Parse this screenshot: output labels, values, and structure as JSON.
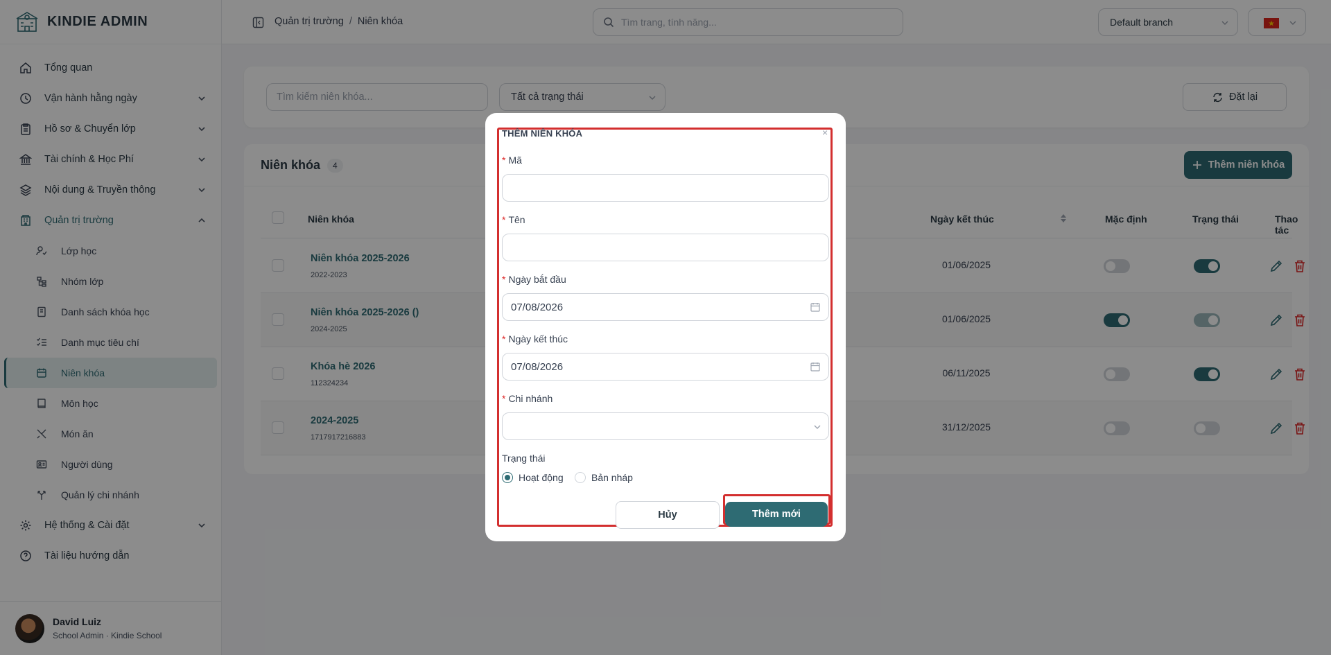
{
  "app": {
    "name": "KINDIE ADMIN"
  },
  "sidebar": {
    "items": [
      {
        "label": "Tổng quan",
        "icon": "home-icon"
      },
      {
        "label": "Vận hành hằng ngày",
        "icon": "clock-icon"
      },
      {
        "label": "Hồ sơ & Chuyển lớp",
        "icon": "clipboard-icon"
      },
      {
        "label": "Tài chính & Học Phí",
        "icon": "bank-icon"
      },
      {
        "label": "Nội dung & Truyền thông",
        "icon": "layers-icon"
      },
      {
        "label": "Quản trị trường",
        "icon": "building-icon"
      },
      {
        "label": "Hệ thống & Cài đặt",
        "icon": "gear-icon"
      },
      {
        "label": "Tài liệu hướng dẫn",
        "icon": "help-icon"
      }
    ],
    "sub_items": [
      {
        "label": "Lớp học",
        "icon": "user-check-icon"
      },
      {
        "label": "Nhóm lớp",
        "icon": "tree-icon"
      },
      {
        "label": "Danh sách khóa học",
        "icon": "book-icon"
      },
      {
        "label": "Danh mục tiêu chí",
        "icon": "checklist-icon"
      },
      {
        "label": "Niên khóa",
        "icon": "calendar-icon"
      },
      {
        "label": "Môn học",
        "icon": "notebook-icon"
      },
      {
        "label": "Món ăn",
        "icon": "utensils-icon"
      },
      {
        "label": "Người dùng",
        "icon": "id-card-icon"
      },
      {
        "label": "Quản lý chi nhánh",
        "icon": "branch-icon"
      }
    ],
    "active_sub": "Niên khóa"
  },
  "user": {
    "name": "David Luiz",
    "role": "School Admin · Kindie School"
  },
  "topbar": {
    "breadcrumb": [
      "Quản trị trường",
      "Niên khóa"
    ],
    "search_placeholder": "Tìm trang, tính năng...",
    "branch": "Default branch",
    "language_flag": "vietnam-flag-icon"
  },
  "filters": {
    "search_placeholder": "Tìm kiếm niên khóa...",
    "status": "Tất cả trạng thái",
    "reset_label": "Đặt lại"
  },
  "list": {
    "title": "Niên khóa",
    "count": "4",
    "add_label": "Thêm niên khóa",
    "columns": {
      "name": "Niên khóa",
      "end_date": "Ngày kết thúc",
      "default": "Mặc định",
      "status": "Trạng thái",
      "actions": "Thao tác"
    },
    "rows": [
      {
        "name": "Niên khóa 2025-2026",
        "code": "2022-2023",
        "end_date": "01/06/2025",
        "is_default": false,
        "status": "on"
      },
      {
        "name": "Niên khóa 2025-2026 ()",
        "code": "2024-2025",
        "end_date": "01/06/2025",
        "is_default": true,
        "status": "disabled-on"
      },
      {
        "name": "Khóa hè 2026",
        "code": "112324234",
        "end_date": "06/11/2025",
        "is_default": false,
        "status": "on"
      },
      {
        "name": "2024-2025",
        "code": "1717917216883",
        "end_date": "31/12/2025",
        "is_default": false,
        "status": "off"
      }
    ]
  },
  "modal": {
    "title": "THÊM NIÊN KHÓA",
    "close_label": "×",
    "fields": {
      "code_label": "Mã",
      "code_value": "",
      "name_label": "Tên",
      "name_value": "",
      "start_label": "Ngày bắt đầu",
      "start_value": "07/08/2026",
      "end_label": "Ngày kết thúc",
      "end_value": "07/08/2026",
      "branch_label": "Chi nhánh",
      "branch_value": ""
    },
    "status_label": "Trạng thái",
    "status_options": [
      "Hoạt động",
      "Bản nháp"
    ],
    "status_selected": "Hoạt động",
    "cancel_label": "Hủy",
    "submit_label": "Thêm mới",
    "highlight_color": "#d32f2f"
  },
  "colors": {
    "accent": "#2e6b73",
    "danger": "#dc2626"
  }
}
